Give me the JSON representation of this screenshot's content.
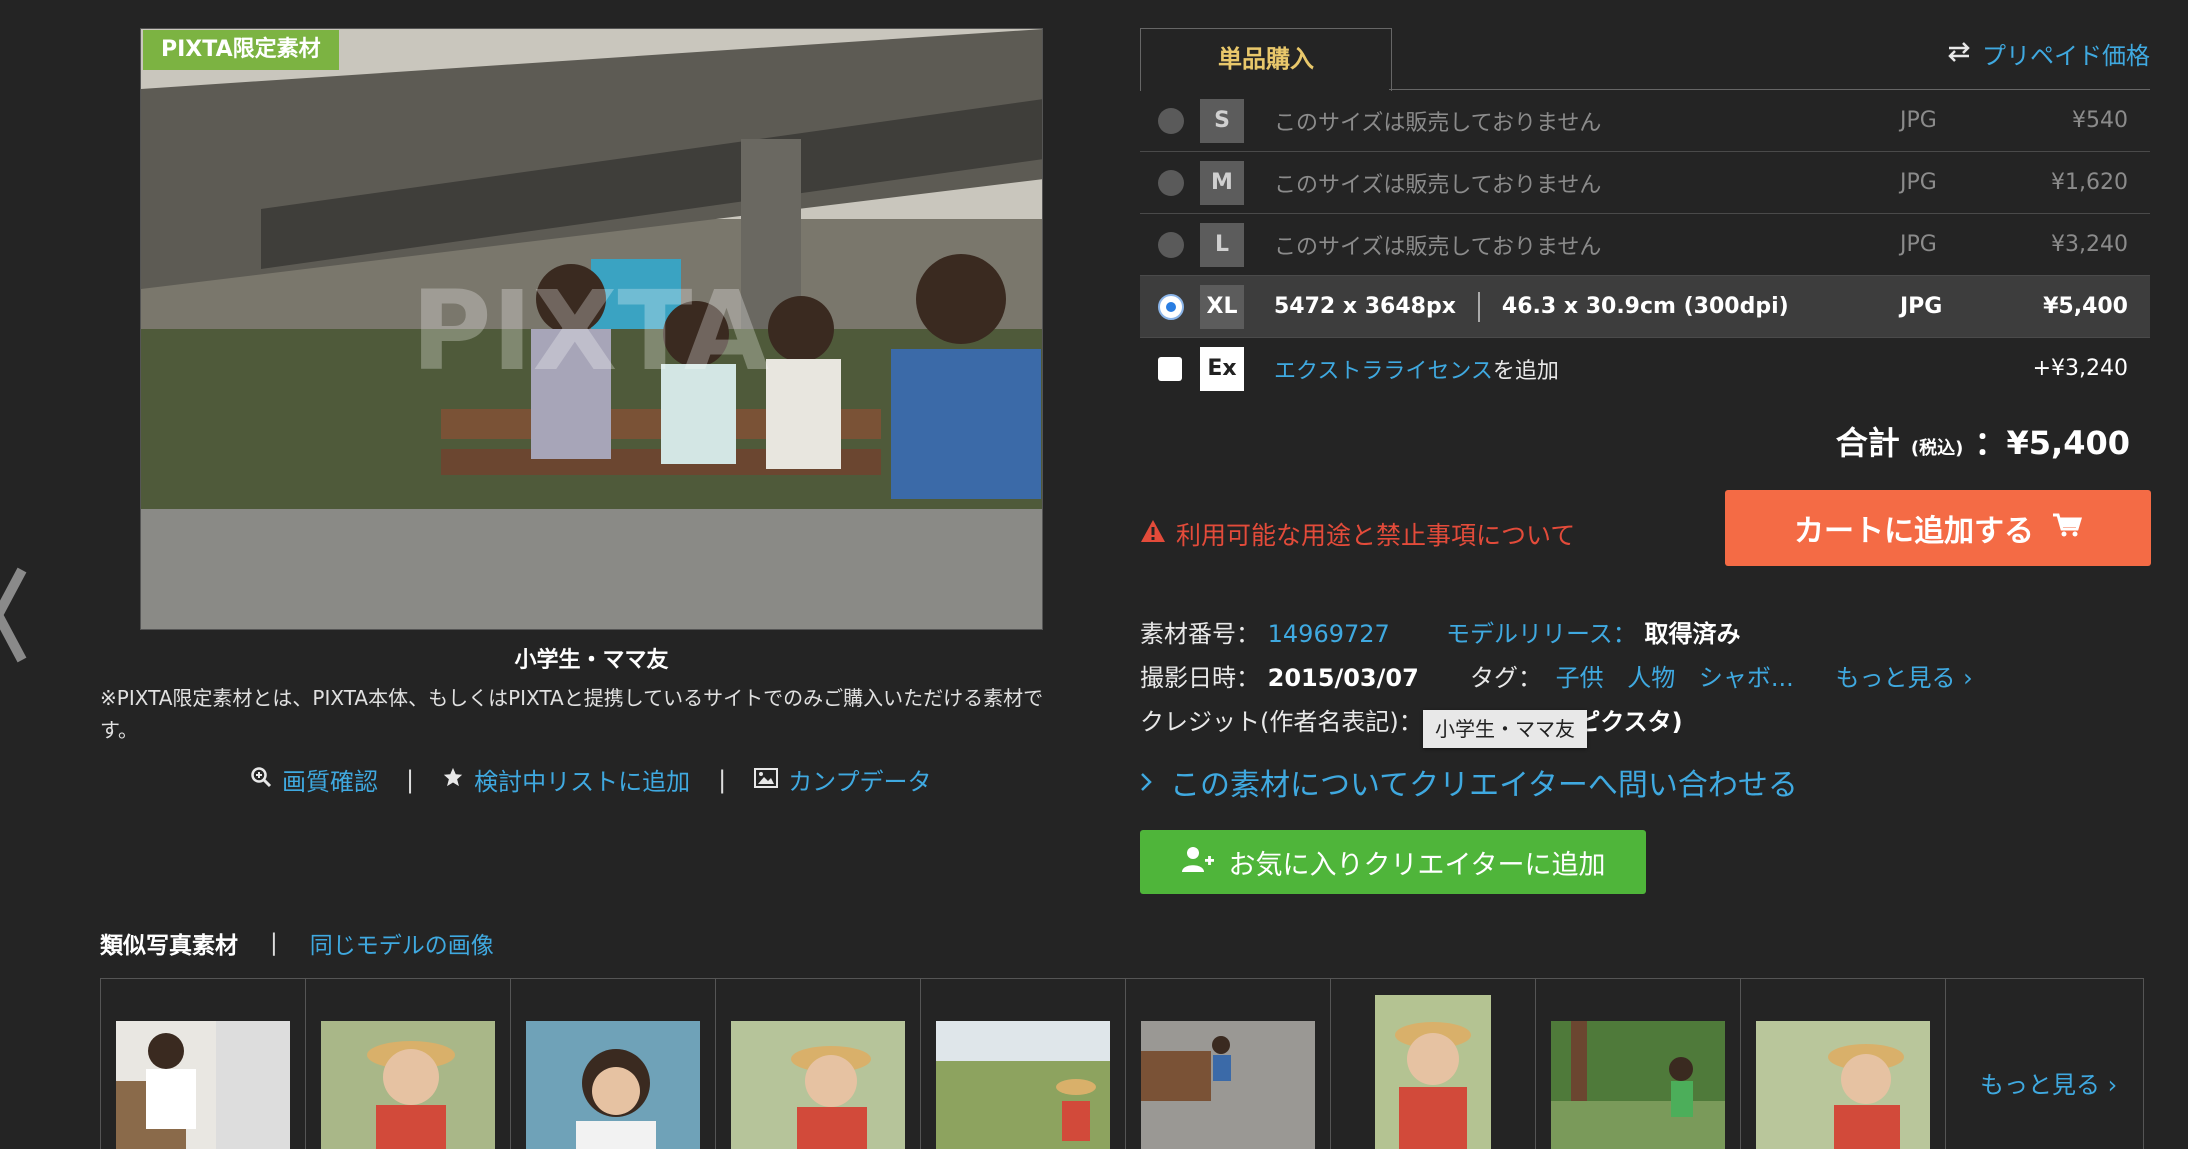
{
  "photo": {
    "badge": "PIXTA限定素材",
    "watermark": "PIXTA",
    "caption": "小学生・ママ友",
    "exclusive_note": "※PIXTA限定素材とは、PIXTA本体、もしくはPIXTAと提携しているサイトでのみご購入いただける素材です。",
    "actions": {
      "quality": "画質確認",
      "wishlist": "検討中リストに追加",
      "comp": "カンプデータ"
    }
  },
  "purchase": {
    "tab_single": "単品購入",
    "prepaid": "プリペイド価格",
    "sizes": [
      {
        "size": "S",
        "desc": "このサイズは販売しておりません",
        "format": "JPG",
        "price": "¥540"
      },
      {
        "size": "M",
        "desc": "このサイズは販売しておりません",
        "format": "JPG",
        "price": "¥1,620"
      },
      {
        "size": "L",
        "desc": "このサイズは販売しておりません",
        "format": "JPG",
        "price": "¥3,240"
      },
      {
        "size": "XL",
        "pixels": "5472 x 3648px",
        "cm": "46.3 x 30.9cm (300dpi)",
        "format": "JPG",
        "price": "¥5,400"
      }
    ],
    "extra_license": {
      "size": "Ex",
      "link": "エクストラライセンス",
      "tail": "を追加",
      "price": "+¥3,240"
    },
    "total_label": "合計",
    "total_tax": "(税込)",
    "total_value": "：¥5,400",
    "usage_warning": "利用可能な用途と禁止事項について",
    "add_to_cart": "カートに追加する"
  },
  "meta": {
    "id_label": "素材番号：",
    "id_value": "14969727",
    "model_label": "モデルリリース：",
    "model_value": "取得済み",
    "date_label": "撮影日時：",
    "date_value": "2015/03/07",
    "tags_label": "タグ：",
    "tags": [
      "子供",
      "人物",
      "シャボ..."
    ],
    "more": "もっと見る ›",
    "credit_label": "クレジット(作者名表記)：",
    "credit_tail": "ピクスタ)",
    "credit_tooltip": "小学生・ママ友",
    "contact": "この素材についてクリエイターへ問い合わせる",
    "favorite": "お気に入りクリエイターに追加"
  },
  "similar": {
    "title": "類似写真素材",
    "same_model": "同じモデルの画像",
    "more": "もっと見る ›"
  },
  "colors": {
    "background": "#242424",
    "link": "#3fa9e0",
    "badge": "#7cb342",
    "cart": "#f46b45",
    "favorite": "#4fb53a",
    "warning": "#e34b3a",
    "tab": "#e9c86b"
  }
}
